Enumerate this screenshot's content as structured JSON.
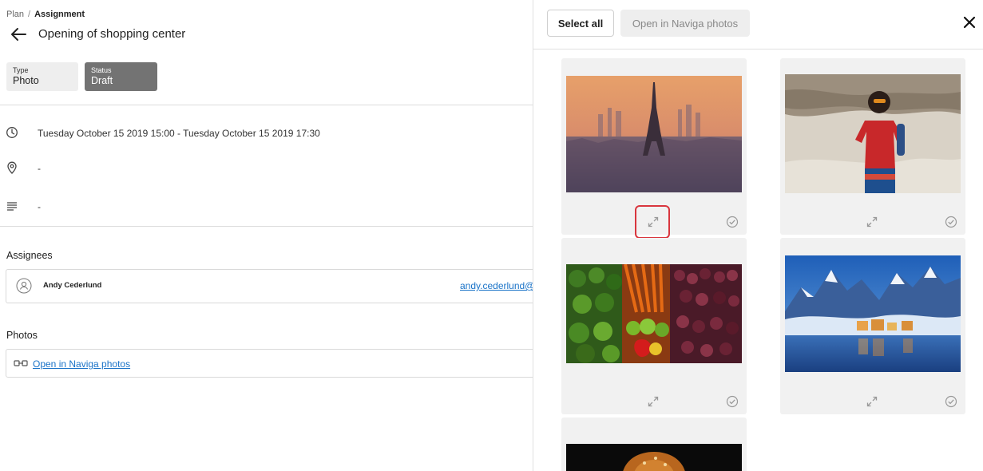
{
  "breadcrumb": {
    "parent": "Plan",
    "separator": "/",
    "current": "Assignment"
  },
  "page_title": "Opening of shopping center",
  "tags": {
    "type": {
      "label": "Type",
      "value": "Photo"
    },
    "status": {
      "label": "Status",
      "value": "Draft"
    }
  },
  "details": {
    "datetime": "Tuesday October 15 2019 15:00 - Tuesday October 15 2019 17:30",
    "location": "-",
    "description": "-"
  },
  "assignees": {
    "heading": "Assignees",
    "items": [
      {
        "name": "Andy Cederlund",
        "email": "andy.cederlund@"
      }
    ]
  },
  "photos": {
    "heading": "Photos",
    "link_label": "Open in Naviga photos"
  },
  "panel": {
    "select_all_label": "Select all",
    "open_label": "Open in Naviga photos",
    "icons": {
      "close": "close-icon",
      "expand": "expand-icon",
      "check": "check-circle-icon"
    }
  },
  "photo_grid": [
    {
      "subject": "eiffel-tower-sunset",
      "selected": false,
      "highlighted": true
    },
    {
      "subject": "woman-red-dress-desert",
      "selected": false,
      "highlighted": false
    },
    {
      "subject": "vegetables-market",
      "selected": false,
      "highlighted": false
    },
    {
      "subject": "snowy-mountain-village",
      "selected": false,
      "highlighted": false
    },
    {
      "subject": "food-dark-background",
      "selected": false,
      "highlighted": false
    }
  ],
  "colors": {
    "accent_link": "#1a73c8",
    "status_tag": "#737373",
    "highlight": "#d9363e"
  }
}
